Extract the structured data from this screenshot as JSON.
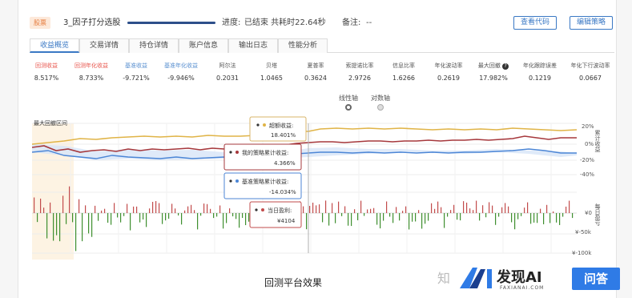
{
  "header": {
    "tag": "股票",
    "strategy_name": "3_因子打分选股",
    "progress_label": "进度:",
    "progress": 1.0,
    "progress_status": "已结束 共耗时22.64秒",
    "note_label": "备注:",
    "note_value": "--",
    "view_code_label": "查看代码",
    "edit_strategy_label": "编辑策略"
  },
  "tabs": [
    {
      "label": "收益概览",
      "active": true
    },
    {
      "label": "交易详情",
      "active": false
    },
    {
      "label": "持仓详情",
      "active": false
    },
    {
      "label": "账户信息",
      "active": false
    },
    {
      "label": "输出日志",
      "active": false
    },
    {
      "label": "性能分析",
      "active": false
    }
  ],
  "metrics": [
    {
      "label": "回测收益",
      "value": "8.517%",
      "color": "red"
    },
    {
      "label": "回测年化收益",
      "value": "8.733%",
      "color": "red"
    },
    {
      "label": "基准收益",
      "value": "-9.721%",
      "color": "blue"
    },
    {
      "label": "基准年化收益",
      "value": "-9.946%",
      "color": "blue"
    },
    {
      "label": "阿尔法",
      "value": "0.2031",
      "color": "gray"
    },
    {
      "label": "贝塔",
      "value": "1.0465",
      "color": "gray"
    },
    {
      "label": "夏普率",
      "value": "0.3624",
      "color": "gray"
    },
    {
      "label": "索提诺比率",
      "value": "2.9726",
      "color": "gray"
    },
    {
      "label": "信息比率",
      "value": "1.6266",
      "color": "gray"
    },
    {
      "label": "年化波动率",
      "value": "0.2619",
      "color": "gray"
    },
    {
      "label": "最大回撤",
      "value": "17.982%",
      "color": "gray",
      "help_icon": "?"
    },
    {
      "label": "年化跟踪误差",
      "value": "0.1219",
      "color": "gray"
    },
    {
      "label": "年化下行波动率",
      "value": "0.0667",
      "color": "gray"
    }
  ],
  "axis_toggle": {
    "linear_label": "线性轴",
    "log_label": "对数轴",
    "selected": "linear"
  },
  "chart": {
    "drawdown_label": "最大回撤区间",
    "right_axis_top": "累计收益",
    "right_axis_bottom": "每日盈亏",
    "top_ticks": [
      "20%",
      "0%",
      "-20%",
      "-40%"
    ],
    "bottom_ticks": [
      "¥0",
      "¥-50k",
      "¥-100k"
    ],
    "tooltips": {
      "excess_label": "超额收益:",
      "excess_value": "18.401%",
      "strategy_label": "我的策略累计收益:",
      "strategy_value": "4.366%",
      "benchmark_label": "基准策略累计收益:",
      "benchmark_value": "-14.034%",
      "daily_label": "当日盈利:",
      "daily_value": "¥4104"
    },
    "colors": {
      "excess": "#e0b447",
      "strategy": "#a6383c",
      "benchmark": "#4c86d6",
      "daily_up": "#c24b4b",
      "daily_down": "#3f8f2f"
    }
  },
  "caption": "回测平台效果",
  "watermark": {
    "zhi": "知",
    "brand": "发现AI",
    "sub": "FAXIANAI.COM",
    "qa": "问答"
  }
}
